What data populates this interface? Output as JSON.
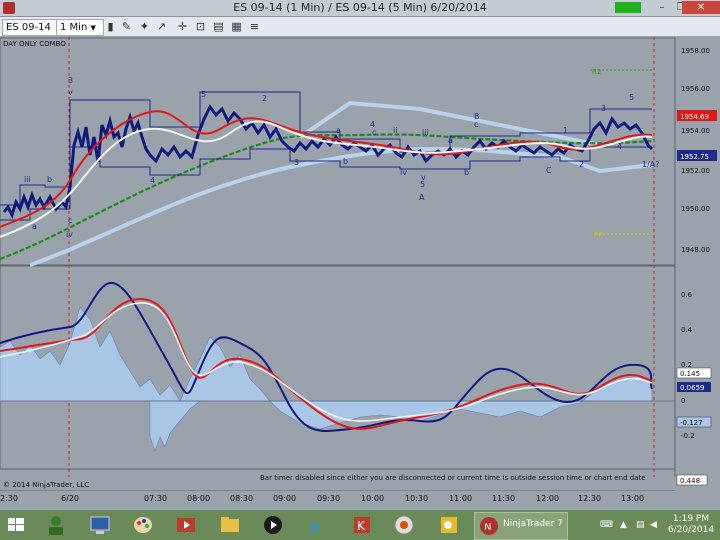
{
  "window": {
    "title": "ES 09-14 (1 Min) / ES 09-14 (5 Min)  6/20/2014",
    "minimize": "–",
    "restore": "❐",
    "close": "✕",
    "status_box": ""
  },
  "toolbar": {
    "instrument": "ES 09-14",
    "interval": "1 Min",
    "icons": [
      "pencil-icon",
      "crosshair-icon",
      "pointer-icon",
      "zoom-icon",
      "properties-icon",
      "chart-style-icon",
      "dataseries-icon"
    ]
  },
  "chart": {
    "session_label": "DAY ONLY COMBO",
    "copyright": "© 2014 NinjaTrader, LLC",
    "timer_message": "Bar timer disabled since either you are disconnected or current time is outside session time or chart end date",
    "price_axis": [
      "1958.00",
      "1956.00",
      "1954.00",
      "1952.00",
      "1950.00",
      "1948.00"
    ],
    "price_markers": {
      "last": "1954.69",
      "close": "1952.75"
    },
    "indicator_axis": [
      "0.6",
      "0.4",
      "0.2",
      "0",
      "-0.2"
    ],
    "indicator_markers": {
      "m1": "0.145",
      "m2": "0.0659",
      "m3": "-0.127",
      "bottom": "0.448"
    },
    "time_axis": [
      "2:30",
      "6/20",
      "07:30",
      "08:00",
      "08:30",
      "09:00",
      "09:30",
      "10:00",
      "10:30",
      "11:00",
      "11:30",
      "12:00",
      "12:30",
      "13:00"
    ],
    "level_labels": {
      "r2": "R2",
      "pp": "PP"
    },
    "wave_labels": [
      "3",
      "v",
      "iii",
      "b",
      "a",
      "c",
      "iv",
      "4",
      "5",
      "2",
      "3",
      "4",
      "b",
      "a",
      "c",
      "ii",
      "iv",
      "v",
      "5",
      "A",
      "iii",
      "b",
      "a",
      "c",
      "B",
      "1",
      "C",
      "2",
      "3",
      "5",
      "4",
      "1/A?"
    ]
  },
  "colors": {
    "band": "#1d2a8c",
    "fast_ma": "#e01818",
    "slow_ma": "#f4f4f4",
    "trend_ma": "#1e8a1e",
    "wide_band": "#b9d3ec",
    "hist": "#aac6e6",
    "osc": "#0e1a7e"
  },
  "taskbar": {
    "apps": [
      "start-icon",
      "user-icon",
      "computer-icon",
      "paint-icon",
      "media-icon",
      "folder-icon",
      "player-icon",
      "ie-icon",
      "kaspersky-icon",
      "settings-icon",
      "outlook-icon"
    ],
    "ninja_label": "NinjaTrader 7",
    "time": "1:19 PM",
    "date": "6/20/2014"
  }
}
